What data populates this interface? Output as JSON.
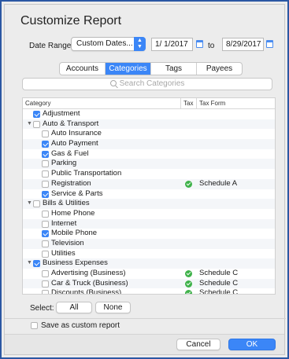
{
  "window": {
    "title": "Customize Report"
  },
  "date_range": {
    "label": "Date Range:",
    "preset": "Custom Dates...",
    "start": "1/  1/2017",
    "to_label": "to",
    "end": "8/29/2017"
  },
  "tabs": [
    {
      "label": "Accounts",
      "active": false
    },
    {
      "label": "Categories",
      "active": true
    },
    {
      "label": "Tags",
      "active": false
    },
    {
      "label": "Payees",
      "active": false
    }
  ],
  "search": {
    "placeholder": "Search Categories"
  },
  "table": {
    "headers": {
      "category": "Category",
      "tax": "Tax",
      "tax_form": "Tax Form"
    },
    "rows": [
      {
        "label": "Adjustment",
        "level": 0,
        "checked": true,
        "group": false,
        "tax": false,
        "form": ""
      },
      {
        "label": "Auto & Transport",
        "level": 0,
        "checked": false,
        "group": true,
        "tax": false,
        "form": ""
      },
      {
        "label": "Auto Insurance",
        "level": 1,
        "checked": false,
        "group": false,
        "tax": false,
        "form": ""
      },
      {
        "label": "Auto Payment",
        "level": 1,
        "checked": true,
        "group": false,
        "tax": false,
        "form": ""
      },
      {
        "label": "Gas & Fuel",
        "level": 1,
        "checked": true,
        "group": false,
        "tax": false,
        "form": ""
      },
      {
        "label": "Parking",
        "level": 1,
        "checked": false,
        "group": false,
        "tax": false,
        "form": ""
      },
      {
        "label": "Public Transportation",
        "level": 1,
        "checked": false,
        "group": false,
        "tax": false,
        "form": ""
      },
      {
        "label": "Registration",
        "level": 1,
        "checked": false,
        "group": false,
        "tax": true,
        "form": "Schedule A"
      },
      {
        "label": "Service & Parts",
        "level": 1,
        "checked": true,
        "group": false,
        "tax": false,
        "form": ""
      },
      {
        "label": "Bills & Utilities",
        "level": 0,
        "checked": false,
        "group": true,
        "tax": false,
        "form": ""
      },
      {
        "label": "Home Phone",
        "level": 1,
        "checked": false,
        "group": false,
        "tax": false,
        "form": ""
      },
      {
        "label": "Internet",
        "level": 1,
        "checked": false,
        "group": false,
        "tax": false,
        "form": ""
      },
      {
        "label": "Mobile Phone",
        "level": 1,
        "checked": true,
        "group": false,
        "tax": false,
        "form": ""
      },
      {
        "label": "Television",
        "level": 1,
        "checked": false,
        "group": false,
        "tax": false,
        "form": ""
      },
      {
        "label": "Utilities",
        "level": 1,
        "checked": false,
        "group": false,
        "tax": false,
        "form": ""
      },
      {
        "label": "Business Expenses",
        "level": 0,
        "checked": true,
        "group": true,
        "tax": false,
        "form": ""
      },
      {
        "label": "Advertising (Business)",
        "level": 1,
        "checked": false,
        "group": false,
        "tax": true,
        "form": "Schedule C"
      },
      {
        "label": "Car & Truck (Business)",
        "level": 1,
        "checked": false,
        "group": false,
        "tax": true,
        "form": "Schedule C"
      },
      {
        "label": "Discounts (Business)",
        "level": 1,
        "checked": false,
        "group": false,
        "tax": true,
        "form": "Schedule C"
      }
    ]
  },
  "select": {
    "label": "Select:",
    "all": "All",
    "none": "None"
  },
  "save_custom": {
    "label": "Save as custom report",
    "checked": false
  },
  "buttons": {
    "cancel": "Cancel",
    "ok": "OK"
  },
  "colors": {
    "accent": "#3b86f7",
    "tax_check": "#3fb24a",
    "frame_border": "#2b57a3"
  }
}
